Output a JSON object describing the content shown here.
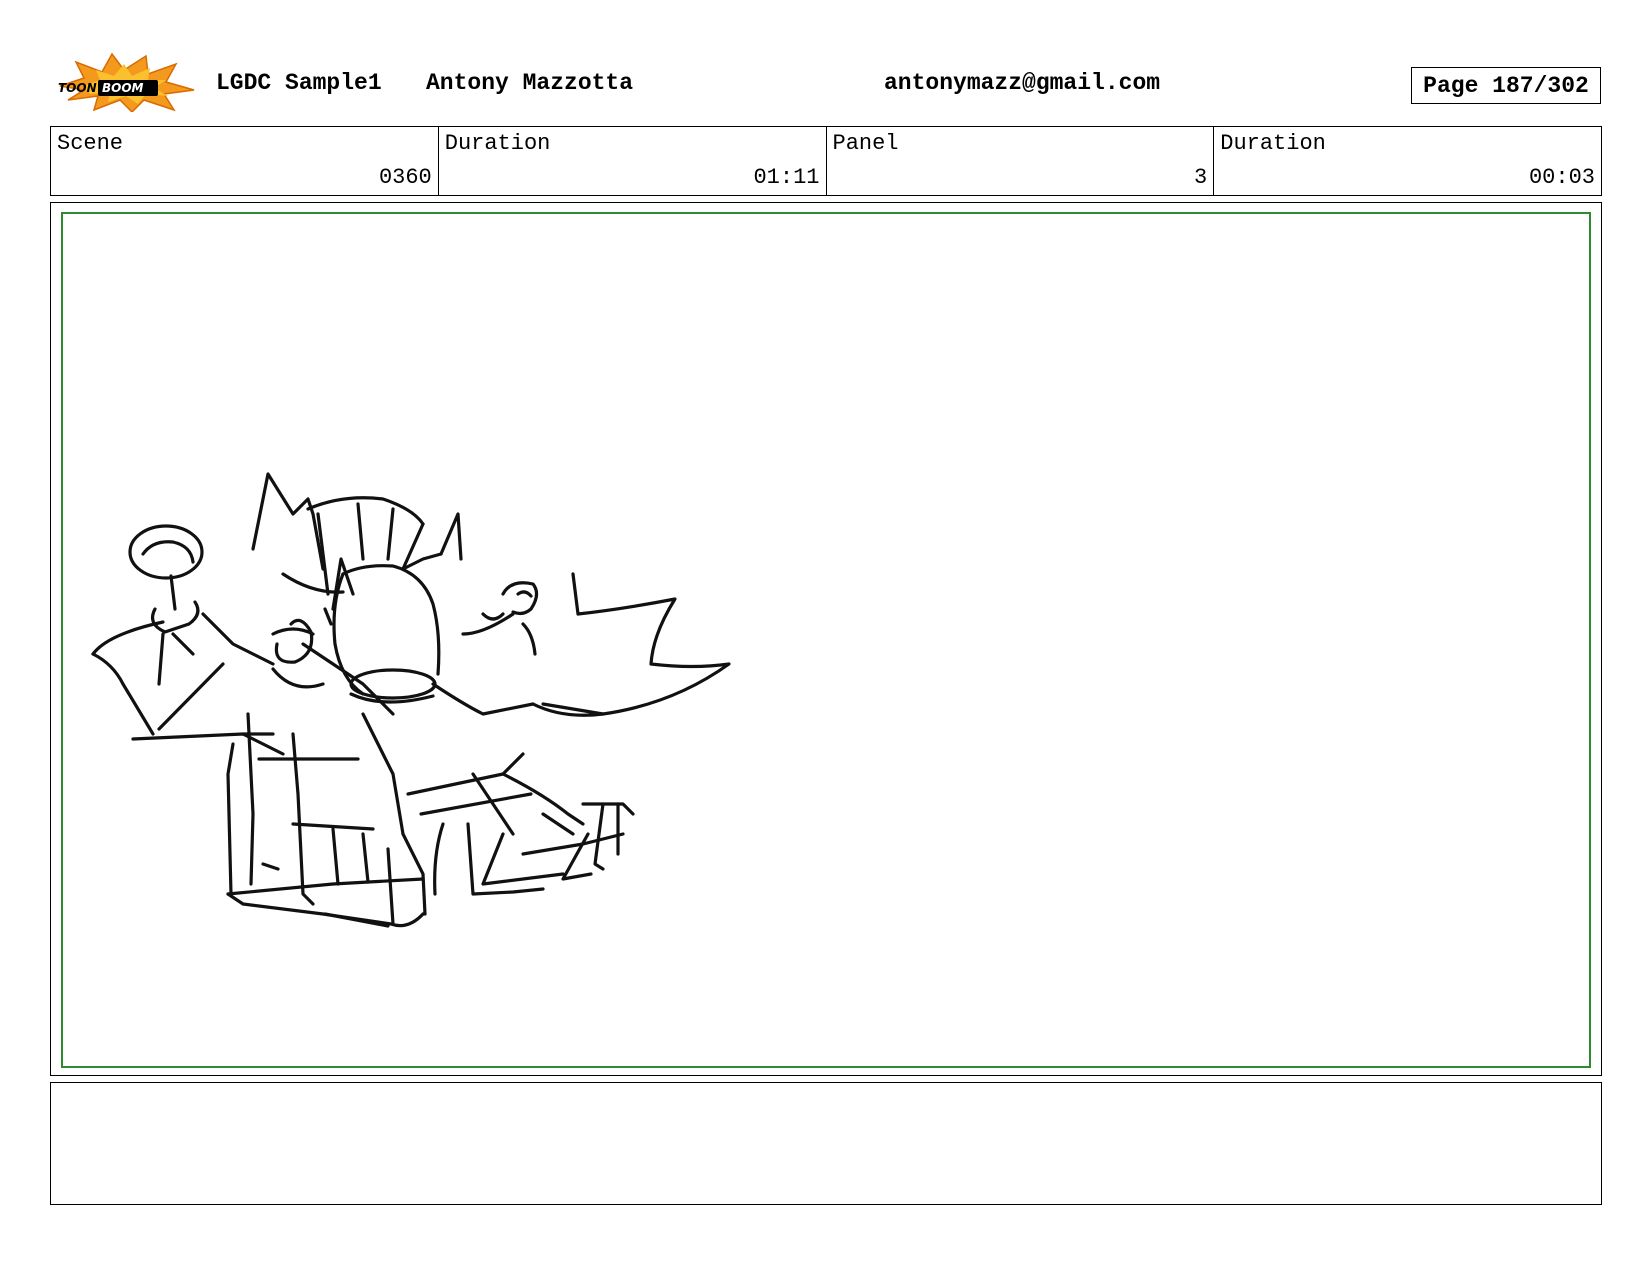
{
  "header": {
    "logo_text": "TOONBOOM",
    "project": "LGDC Sample1",
    "author": "Antony Mazzotta",
    "email": "antonymazz@gmail.com",
    "page": "Page 187/302"
  },
  "info": {
    "scene_label": "Scene",
    "scene_value": "0360",
    "scene_duration_label": "Duration",
    "scene_duration_value": "01:11",
    "panel_label": "Panel",
    "panel_value": "3",
    "panel_duration_label": "Duration",
    "panel_duration_value": "00:03"
  },
  "notes": {
    "text": ""
  },
  "colors": {
    "panel_border": "#2e8b2e",
    "logo_burst": "#f39a1e",
    "logo_inner": "#fbc02d"
  }
}
